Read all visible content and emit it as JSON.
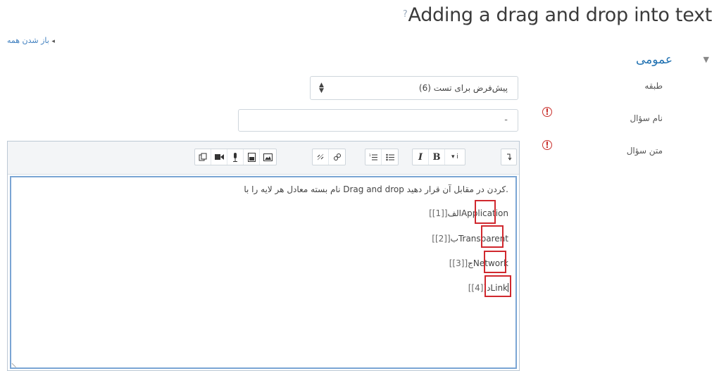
{
  "page": {
    "title": "Adding a drag and drop into text",
    "help_icon": "help-circle-icon",
    "expand_all": "باز شدن همه",
    "section_title": "عمومی"
  },
  "form": {
    "category": {
      "label": "طبقه",
      "value": "پیش‌فرض برای تست (6)"
    },
    "question_name": {
      "label": "نام سؤال",
      "value": "-"
    },
    "question_text": {
      "label": "متن سؤال"
    }
  },
  "editor": {
    "toolbar_icons": [
      "expand-toolbar-icon",
      "paragraph-style-icon",
      "bold-icon",
      "italic-icon",
      "bullet-list-icon",
      "numbered-list-icon",
      "link-icon",
      "unlink-icon",
      "image-icon",
      "media-icon",
      "record-audio-icon",
      "record-video-icon",
      "manage-files-icon"
    ],
    "intro_line": "نام بسته معادل هر لایه را با Drag and drop  کردن در مقابل آن قرار دهید.",
    "rows": [
      {
        "prefix": "الف",
        "word": "Application",
        "token": "[[1]]"
      },
      {
        "prefix": "ب",
        "word": "Transparent",
        "token": "[[2]]"
      },
      {
        "prefix": "ج",
        "word": "Network",
        "token": "[[3]]"
      },
      {
        "prefix": "د",
        "word": "Link",
        "token": "[[4]]"
      }
    ]
  },
  "colors": {
    "link": "#3f7fbf",
    "required": "#c9302c",
    "highlight_box": "#d0282e",
    "editor_focus": "#7aa5d4"
  }
}
